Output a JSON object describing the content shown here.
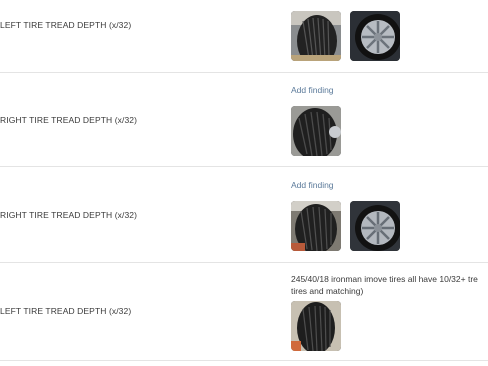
{
  "rows": [
    {
      "label": "LEFT TIRE TREAD DEPTH (x/32)",
      "photos": [
        "tread-photo",
        "wheel-photo"
      ]
    },
    {
      "label": "RIGHT TIRE TREAD DEPTH (x/32)",
      "action": "Add finding",
      "photos": [
        "tread-photo"
      ]
    },
    {
      "label": "RIGHT TIRE TREAD DEPTH (x/32)",
      "action": "Add finding",
      "photos": [
        "tread-photo",
        "wheel-photo"
      ]
    },
    {
      "label": "LEFT TIRE TREAD DEPTH (x/32)",
      "note_line1": "245/40/18 ironman imove tires all have 10/32+ tre",
      "note_line2": "tires and matching)",
      "photos": [
        "tread-photo"
      ]
    }
  ]
}
